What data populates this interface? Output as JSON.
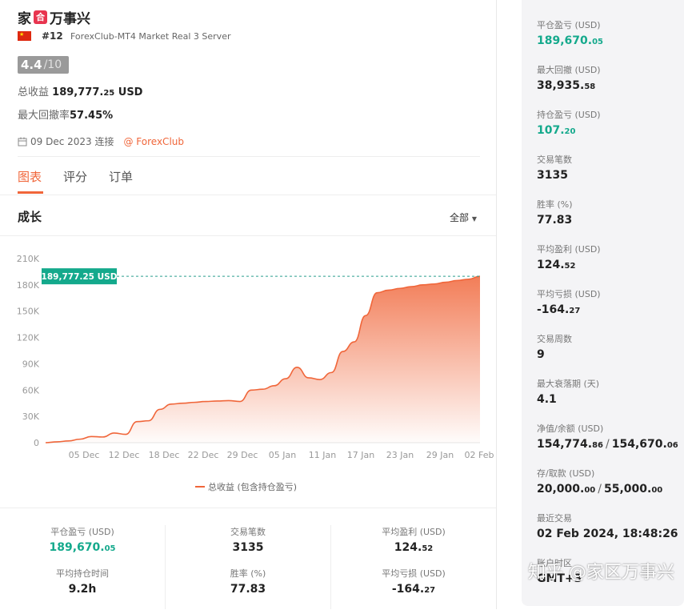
{
  "header": {
    "name_part1": "家",
    "name_badge": "合",
    "name_part2": "万事兴",
    "rank": "#12",
    "server": "ForexClub-MT4 Market Real 3 Server",
    "score": "4.4",
    "score_max": "/10",
    "total_profit_label": "总收益",
    "total_profit_int": "189,777.",
    "total_profit_dec": "25",
    "total_profit_unit": " USD",
    "max_drawdown_label": "最大回撤率",
    "max_drawdown_value": "57.45%",
    "connected_date": "09 Dec 2023 连接",
    "broker": "@ ForexClub"
  },
  "tabs": [
    {
      "label": "图表",
      "active": true
    },
    {
      "label": "评分",
      "active": false
    },
    {
      "label": "订单",
      "active": false
    }
  ],
  "chart_section": {
    "title": "成长",
    "range_select": "全部"
  },
  "chart_data": {
    "type": "area",
    "y_ticks": [
      "210K",
      "180K",
      "150K",
      "120K",
      "90K",
      "60K",
      "30K",
      "0"
    ],
    "ylim": [
      0,
      210000
    ],
    "x_ticks": [
      "05 Dec",
      "12 Dec",
      "18 Dec",
      "22 Dec",
      "29 Dec",
      "05 Jan",
      "11 Jan",
      "17 Jan",
      "23 Jan",
      "29 Jan",
      "02 Feb"
    ],
    "current_label": "189,777.25 USD",
    "current_value": 189777.25,
    "series": [
      {
        "name": "总收益 (包含持仓盈亏)",
        "values": [
          0,
          1000,
          2000,
          4000,
          7000,
          6500,
          11000,
          9500,
          24000,
          25000,
          38000,
          44000,
          45000,
          46000,
          47000,
          47500,
          48000,
          47000,
          60000,
          61000,
          65000,
          73000,
          86000,
          74000,
          72000,
          80000,
          104000,
          115000,
          145000,
          171000,
          174000,
          176000,
          178000,
          180000,
          181000,
          183000,
          185000,
          186500,
          189777.25
        ],
        "color": "#f0663a"
      }
    ]
  },
  "bottom_stats": [
    {
      "label": "平仓盈亏 (USD)",
      "int": "189,670.",
      "dec": "05",
      "green": true
    },
    {
      "label": "交易笔数",
      "int": "3135",
      "dec": "",
      "green": false
    },
    {
      "label": "平均盈利 (USD)",
      "int": "124.",
      "dec": "52",
      "green": false
    },
    {
      "label": "平均持仓时间",
      "int": "9.2h",
      "dec": "",
      "green": false
    },
    {
      "label": "胜率 (%)",
      "int": "77.83",
      "dec": "",
      "green": false
    },
    {
      "label": "平均亏损 (USD)",
      "int": "-164.",
      "dec": "27",
      "green": false
    }
  ],
  "side_stats": [
    {
      "label": "平仓盈亏 (USD)",
      "int": "189,670.",
      "dec": "05",
      "green": true
    },
    {
      "label": "最大回撤 (USD)",
      "int": "38,935.",
      "dec": "58",
      "green": false
    },
    {
      "label": "持仓盈亏 (USD)",
      "int": "107.",
      "dec": "20",
      "green": true
    },
    {
      "label": "交易笔数",
      "int": "3135",
      "dec": "",
      "green": false
    },
    {
      "label": "胜率 (%)",
      "int": "77.83",
      "dec": "",
      "green": false
    },
    {
      "label": "平均盈利 (USD)",
      "int": "124.",
      "dec": "52",
      "green": false
    },
    {
      "label": "平均亏损 (USD)",
      "int": "-164.",
      "dec": "27",
      "green": false
    },
    {
      "label": "交易周数",
      "int": "9",
      "dec": "",
      "green": false
    },
    {
      "label": "最大衰落期 (天)",
      "int": "4.1",
      "dec": "",
      "green": false
    },
    {
      "label": "净值/余额 (USD)",
      "int": "154,774.",
      "dec": "86",
      "int2": "154,670.",
      "dec2": "06",
      "green": false
    },
    {
      "label": "存/取款 (USD)",
      "int": "20,000.",
      "dec": "00",
      "int2": "55,000.",
      "dec2": "00",
      "green": false
    },
    {
      "label": "最近交易",
      "int": "02 Feb 2024, 18:48:26",
      "dec": "",
      "green": false
    },
    {
      "label": "账户时区",
      "int": "GMT+3",
      "dec": "",
      "green": false
    }
  ],
  "watermark": "知乎 @家区万事兴"
}
